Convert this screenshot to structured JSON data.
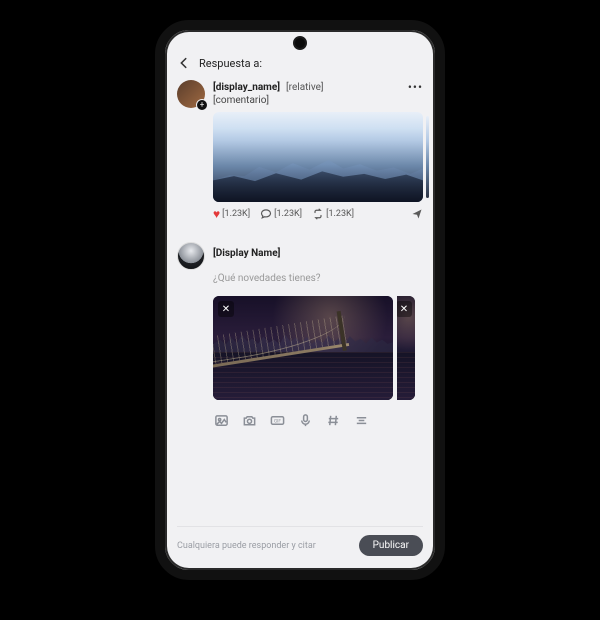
{
  "header": {
    "title": "Respuesta a:"
  },
  "original_post": {
    "display_name": "[display_name]",
    "relative_time": "[relative]",
    "comment": "[comentario]",
    "like_count": "[1.23K]",
    "reply_count": "[1.23K]",
    "repost_count": "[1.23K]"
  },
  "composer": {
    "display_name": "[Display Name]",
    "placeholder": "¿Qué novedades tienes?"
  },
  "footer": {
    "reply_note": "Cualquiera puede responder y citar",
    "publish_label": "Publicar"
  }
}
